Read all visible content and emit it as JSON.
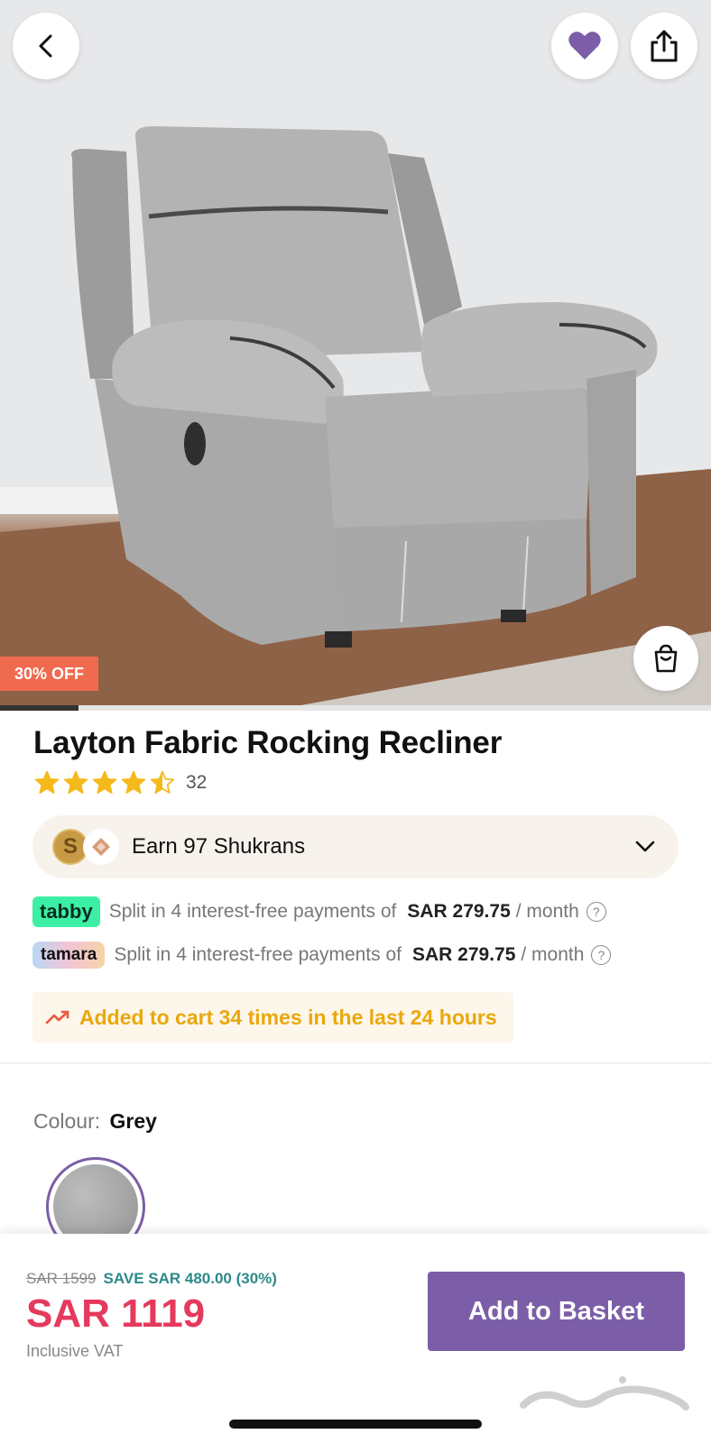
{
  "product": {
    "title": "Layton Fabric Rocking Recliner",
    "rating": 4.5,
    "review_count": "32",
    "discount_badge": "30% OFF",
    "image_progress": 0.11
  },
  "header": {
    "back_icon": "chevron-left-icon",
    "favorite_icon": "heart-icon",
    "share_icon": "share-icon",
    "cart_icon": "shopping-bag-icon"
  },
  "shukran": {
    "coin_letter": "S",
    "text": "Earn 97 Shukrans"
  },
  "payments": [
    {
      "provider": "tabby",
      "text": "Split in 4 interest-free payments of",
      "amount": "SAR 279.75",
      "period": "/ month",
      "help": "?"
    },
    {
      "provider": "tamara",
      "text": "Split in 4 interest-free payments of",
      "amount": "SAR 279.75",
      "period": "/ month",
      "help": "?"
    }
  ],
  "trend": {
    "text": "Added to cart 34 times in the last 24 hours"
  },
  "colour": {
    "label": "Colour:",
    "value": "Grey"
  },
  "pricing": {
    "old_price": "SAR 1599",
    "save_text": "SAVE SAR 480.00 (30%)",
    "current_price": "SAR 1119",
    "vat_note": "Inclusive VAT"
  },
  "actions": {
    "add_to_basket": "Add to Basket"
  },
  "colors": {
    "accent_purple": "#7b5ea7",
    "price_red": "#e5395d",
    "save_teal": "#2d8a8a",
    "badge_orange": "#ef6a4f",
    "trend_yellow": "#e9a80c",
    "tabby_green": "#3bf0a5"
  }
}
